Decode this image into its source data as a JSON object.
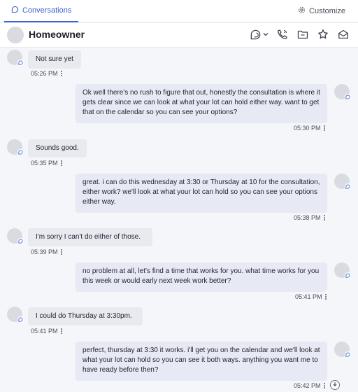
{
  "tabs": {
    "conversations_label": "Conversations",
    "customize_label": "Customize"
  },
  "contact": {
    "name": "Homeowner"
  },
  "header_icons": [
    "chat-dropdown-icon",
    "phone-icon",
    "folder-icon",
    "star-icon",
    "mail-icon"
  ],
  "messages": [
    {
      "direction": "inbound",
      "text": "Not sure yet",
      "time": "05:26 PM"
    },
    {
      "direction": "outbound",
      "text": "Ok well there's no rush to figure that out, honestly the consultation is where it gets clear since we can look at what your lot can hold either way. want to get that on the calendar so you can see your options?",
      "time": "05:30 PM"
    },
    {
      "direction": "inbound",
      "text": "Sounds good.",
      "time": "05:35 PM"
    },
    {
      "direction": "outbound",
      "text": "great. i can do this wednesday at 3:30 or Thursday at 10 for the consultation, either work? we'll look at what your lot can hold so you can see your options either way.",
      "time": "05:38 PM"
    },
    {
      "direction": "inbound",
      "text": "I'm sorry I can't do either of those.",
      "time": "05:39 PM"
    },
    {
      "direction": "outbound",
      "text": "no problem at all, let's find a time that works for you. what time works for you this week or would early next week work better?",
      "time": "05:41 PM"
    },
    {
      "direction": "inbound",
      "text": "I could do Thursday at 3:30pm.",
      "time": "05:41 PM"
    },
    {
      "direction": "outbound",
      "text": "perfect, thursday at 3:30 it works. i'll get you on the calendar and we'll look at what your lot can hold so you can see it both ways. anything you want me to have ready before then?",
      "time": "05:42 PM"
    }
  ],
  "colors": {
    "accent": "#3a63d6",
    "inbound_bubble": "#e9eaf0",
    "outbound_bubble": "#e7e9f5",
    "background": "#f5f6f9"
  }
}
